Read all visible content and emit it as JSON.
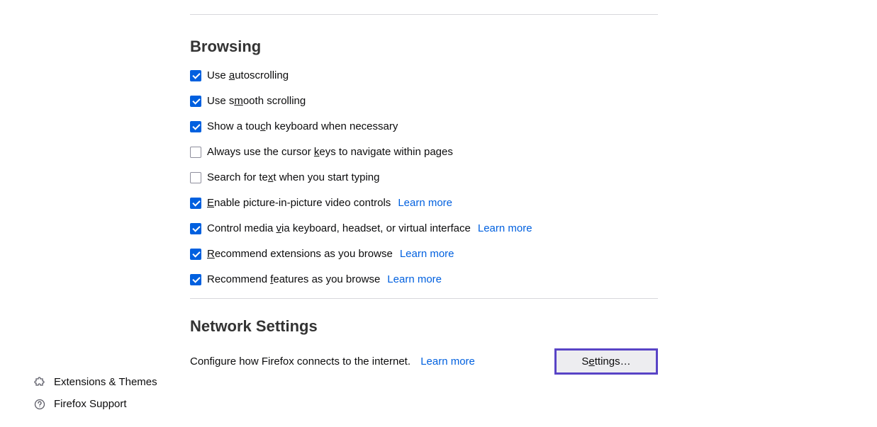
{
  "browsing": {
    "title": "Browsing",
    "items": [
      {
        "checked": true,
        "pre": "Use ",
        "uchar": "a",
        "post": "utoscrolling",
        "learn": null
      },
      {
        "checked": true,
        "pre": "Use s",
        "uchar": "m",
        "post": "ooth scrolling",
        "learn": null
      },
      {
        "checked": true,
        "pre": "Show a tou",
        "uchar": "c",
        "post": "h keyboard when necessary",
        "learn": null
      },
      {
        "checked": false,
        "pre": "Always use the cursor ",
        "uchar": "k",
        "post": "eys to navigate within pages",
        "learn": null
      },
      {
        "checked": false,
        "pre": "Search for te",
        "uchar": "x",
        "post": "t when you start typing",
        "learn": null
      },
      {
        "checked": true,
        "pre": "",
        "uchar": "E",
        "post": "nable picture-in-picture video controls",
        "learn": "Learn more"
      },
      {
        "checked": true,
        "pre": "Control media ",
        "uchar": "v",
        "post": "ia keyboard, headset, or virtual interface",
        "learn": "Learn more"
      },
      {
        "checked": true,
        "pre": "",
        "uchar": "R",
        "post": "ecommend extensions as you browse",
        "learn": "Learn more"
      },
      {
        "checked": true,
        "pre": "Recommend ",
        "uchar": "f",
        "post": "eatures as you browse",
        "learn": "Learn more"
      }
    ]
  },
  "network": {
    "title": "Network Settings",
    "desc": "Configure how Firefox connects to the internet.",
    "learn": "Learn more",
    "button_pre": "S",
    "button_u": "e",
    "button_post": "ttings…"
  },
  "sidebar": {
    "extensions": "Extensions & Themes",
    "support": "Firefox Support"
  }
}
